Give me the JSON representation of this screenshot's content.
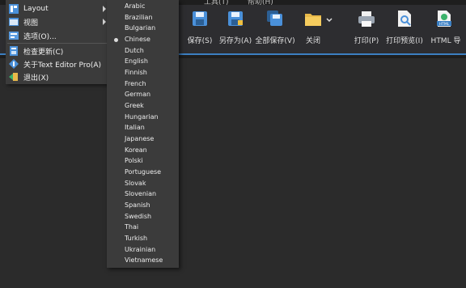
{
  "tabs": [
    "工具(T)",
    "帮助(H)"
  ],
  "toolbar": {
    "save": "保存(S)",
    "save_as": "另存为(A)",
    "save_all": "全部保存(V)",
    "close": "关闭",
    "print": "打印(P)",
    "print_preview": "打印预览(I)",
    "html": "HTML 导",
    "html_icon_text": "HTML"
  },
  "menu": {
    "items": [
      {
        "label": "Layout",
        "icon": "layout-icon",
        "submenu": true
      },
      {
        "label": "视图",
        "icon": "view-icon",
        "submenu": true
      },
      {
        "label": "选项(O)...",
        "icon": "options-icon",
        "submenu": false
      },
      {
        "label": "检查更新(C)",
        "icon": "update-icon",
        "submenu": false
      },
      {
        "label": "关于Text Editor Pro(A)",
        "icon": "about-icon",
        "submenu": false
      },
      {
        "label": "退出(X)",
        "icon": "exit-icon",
        "submenu": false
      }
    ]
  },
  "languages": {
    "selected": "Chinese",
    "items": [
      "Arabic",
      "Brazilian",
      "Bulgarian",
      "Chinese",
      "Dutch",
      "English",
      "Finnish",
      "French",
      "German",
      "Greek",
      "Hungarian",
      "Italian",
      "Japanese",
      "Korean",
      "Polski",
      "Portuguese",
      "Slovak",
      "Slovenian",
      "Spanish",
      "Swedish",
      "Thai",
      "Turkish",
      "Ukrainian",
      "Vietnamese"
    ]
  },
  "colors": {
    "accent": "#3c7fc1",
    "background": "#2d2d30",
    "menu": "#3b3b3b"
  }
}
